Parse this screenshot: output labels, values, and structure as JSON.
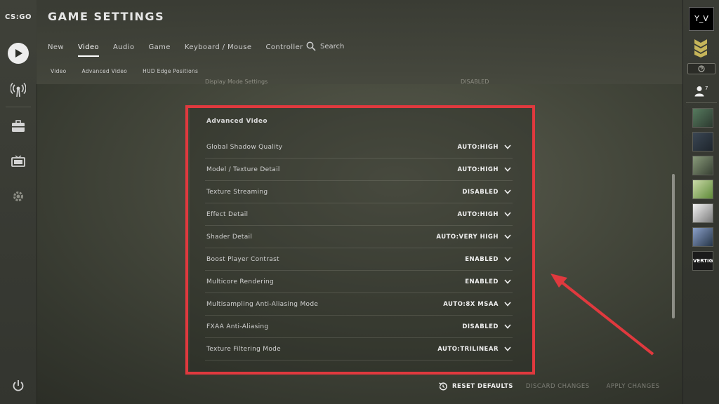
{
  "app": {
    "logo_text": "CS:GO",
    "title": "GAME SETTINGS"
  },
  "tabs": [
    "New",
    "Video",
    "Audio",
    "Game",
    "Keyboard / Mouse",
    "Controller"
  ],
  "active_tab": "Video",
  "search_label": "Search",
  "subtabs": [
    "Video",
    "Advanced Video",
    "HUD Edge Positions"
  ],
  "partial_row": {
    "label": "Display Mode Settings",
    "value": "DISABLED"
  },
  "panel": {
    "heading": "Advanced Video",
    "rows": [
      {
        "label": "Global Shadow Quality",
        "value": "AUTO:HIGH"
      },
      {
        "label": "Model / Texture Detail",
        "value": "AUTO:HIGH"
      },
      {
        "label": "Texture Streaming",
        "value": "DISABLED"
      },
      {
        "label": "Effect Detail",
        "value": "AUTO:HIGH"
      },
      {
        "label": "Shader Detail",
        "value": "AUTO:VERY HIGH"
      },
      {
        "label": "Boost Player Contrast",
        "value": "ENABLED"
      },
      {
        "label": "Multicore Rendering",
        "value": "ENABLED"
      },
      {
        "label": "Multisampling Anti-Aliasing Mode",
        "value": "AUTO:8X MSAA"
      },
      {
        "label": "FXAA Anti-Aliasing",
        "value": "DISABLED"
      },
      {
        "label": "Texture Filtering Mode",
        "value": "AUTO:TRILINEAR"
      }
    ]
  },
  "actions": {
    "reset": "RESET DEFAULTS",
    "discard": "DISCARD CHANGES",
    "apply": "APPLY CHANGES"
  },
  "friends": {
    "main_avatar_text": "Y_V",
    "friend_count": "7",
    "last_avatar_text": "VERTIGO"
  },
  "colors": {
    "highlight": "#e0393e",
    "accent": "#ffffff"
  }
}
